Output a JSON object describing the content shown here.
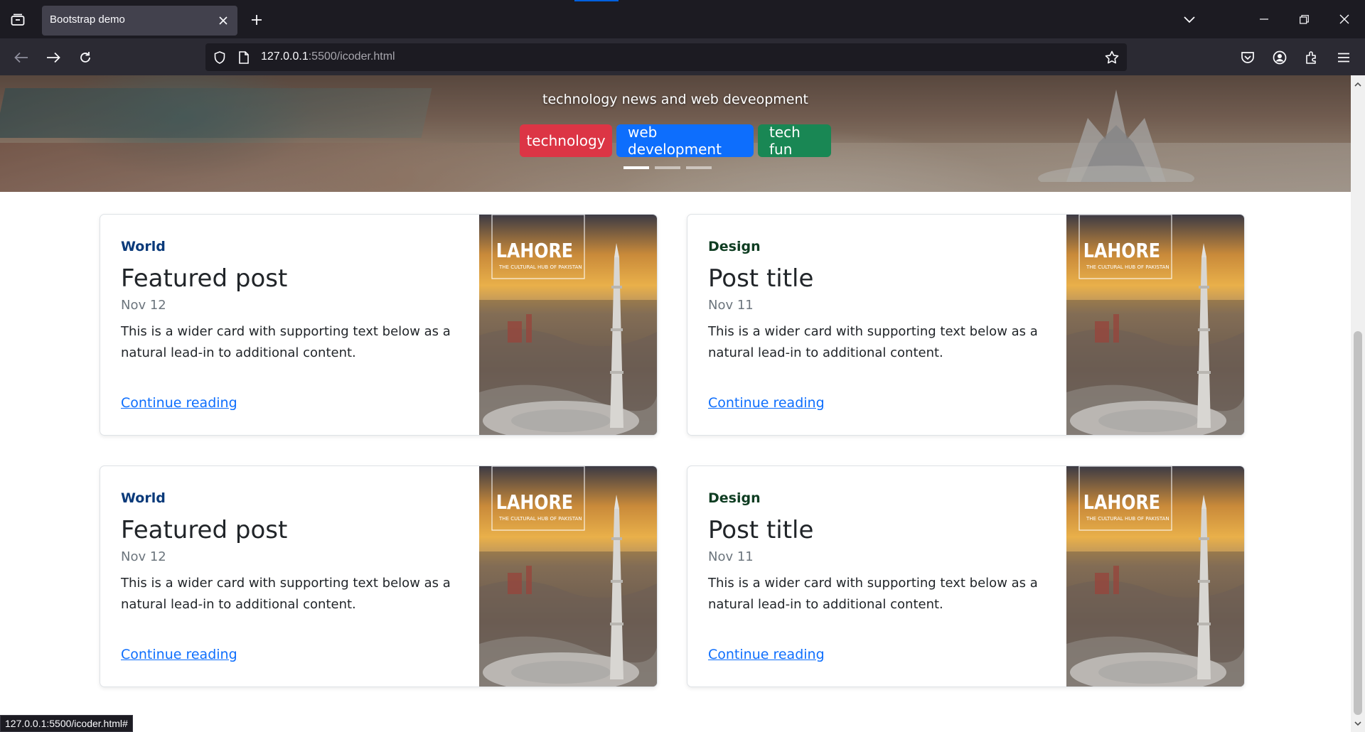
{
  "browser": {
    "tab_title": "Bootstrap demo",
    "url_host": "127.0.0.1",
    "url_rest": ":5500/icoder.html",
    "status_url": "127.0.0.1:5500/icoder.html#"
  },
  "hero": {
    "subtitle": "technology news and web deveopment",
    "buttons": {
      "technology": "technology",
      "web_development": "web development",
      "tech_fun": "tech fun"
    },
    "active_slide": 1,
    "slide_count": 3
  },
  "cards": [
    {
      "category": "World",
      "title": "Featured post",
      "date": "Nov 12",
      "text": "This is a wider card with supporting text below as a natural lead-in to additional content.",
      "link": "Continue reading",
      "image_title": "LAHORE",
      "image_subtitle": "THE CULTURAL HUB OF PAKISTAN"
    },
    {
      "category": "Design",
      "title": "Post title",
      "date": "Nov 11",
      "text": "This is a wider card with supporting text below as a natural lead-in to additional content.",
      "link": "Continue reading",
      "image_title": "LAHORE",
      "image_subtitle": "THE CULTURAL HUB OF PAKISTAN"
    },
    {
      "category": "World",
      "title": "Featured post",
      "date": "Nov 12",
      "text": "This is a wider card with supporting text below as a natural lead-in to additional content.",
      "link": "Continue reading",
      "image_title": "LAHORE",
      "image_subtitle": "THE CULTURAL HUB OF PAKISTAN"
    },
    {
      "category": "Design",
      "title": "Post title",
      "date": "Nov 11",
      "text": "This is a wider card with supporting text below as a natural lead-in to additional content.",
      "link": "Continue reading",
      "image_title": "LAHORE",
      "image_subtitle": "THE CULTURAL HUB OF PAKISTAN"
    }
  ],
  "colors": {
    "world": "#0a3a7a",
    "design": "#0f3d22",
    "link": "#0d6efd",
    "btn_red": "#dc3545",
    "btn_blue": "#0d6efd",
    "btn_green": "#198754"
  },
  "icons": [
    "tab-list-icon",
    "close-icon",
    "plus-icon",
    "chevron-down-icon",
    "minimize-icon",
    "restore-icon",
    "back-icon",
    "forward-icon",
    "reload-icon",
    "shield-icon",
    "page-icon",
    "star-icon",
    "pocket-icon",
    "account-icon",
    "extensions-icon",
    "menu-icon"
  ]
}
